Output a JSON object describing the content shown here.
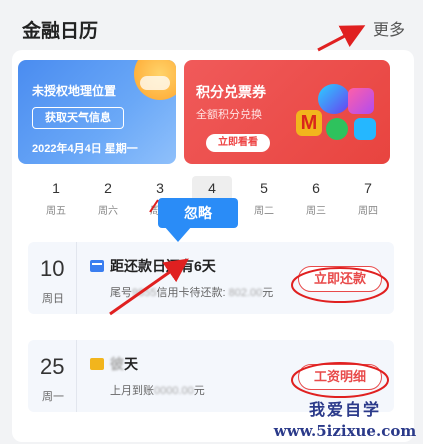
{
  "header": {
    "title": "金融日历",
    "more": "更多"
  },
  "weather_banner": {
    "title": "未授权地理位置",
    "button": "获取天气信息",
    "date": "2022年4月4日 星期一"
  },
  "points_banner": {
    "title": "积分兑票券",
    "subtitle": "全额积分兑换",
    "button": "立即看看",
    "logo_letter": "M"
  },
  "calendar": {
    "days": [
      {
        "num": "1",
        "week": "周五"
      },
      {
        "num": "2",
        "week": "周六"
      },
      {
        "num": "3",
        "week": "周日"
      },
      {
        "num": "4",
        "week": "周一"
      },
      {
        "num": "5",
        "week": "周二"
      },
      {
        "num": "6",
        "week": "周三"
      },
      {
        "num": "7",
        "week": "周四"
      }
    ],
    "active_index": 3
  },
  "tooltip": {
    "label": "忽略"
  },
  "events": [
    {
      "day": "10",
      "week": "周日",
      "title": "距还款日还有6天",
      "detail_prefix": "尾号",
      "detail_masked_1": "9855",
      "detail_middle": "信用卡待还款: ",
      "detail_masked_2": "802.00",
      "detail_suffix": "元",
      "button": "立即还款"
    },
    {
      "day": "25",
      "week": "周一",
      "title_masked": "彼",
      "title_suffix": "天",
      "detail_prefix": "上月到账",
      "detail_masked": "0000.00",
      "detail_suffix": "元",
      "button": "工资明细"
    }
  ],
  "watermark": {
    "cn": "我爱自学",
    "url": "www.5izixue.com"
  },
  "colors": {
    "accent_blue": "#2a8cf7",
    "accent_red": "#e84a4a",
    "annotation_red": "#e02020",
    "watermark": "#2b3a8a"
  }
}
